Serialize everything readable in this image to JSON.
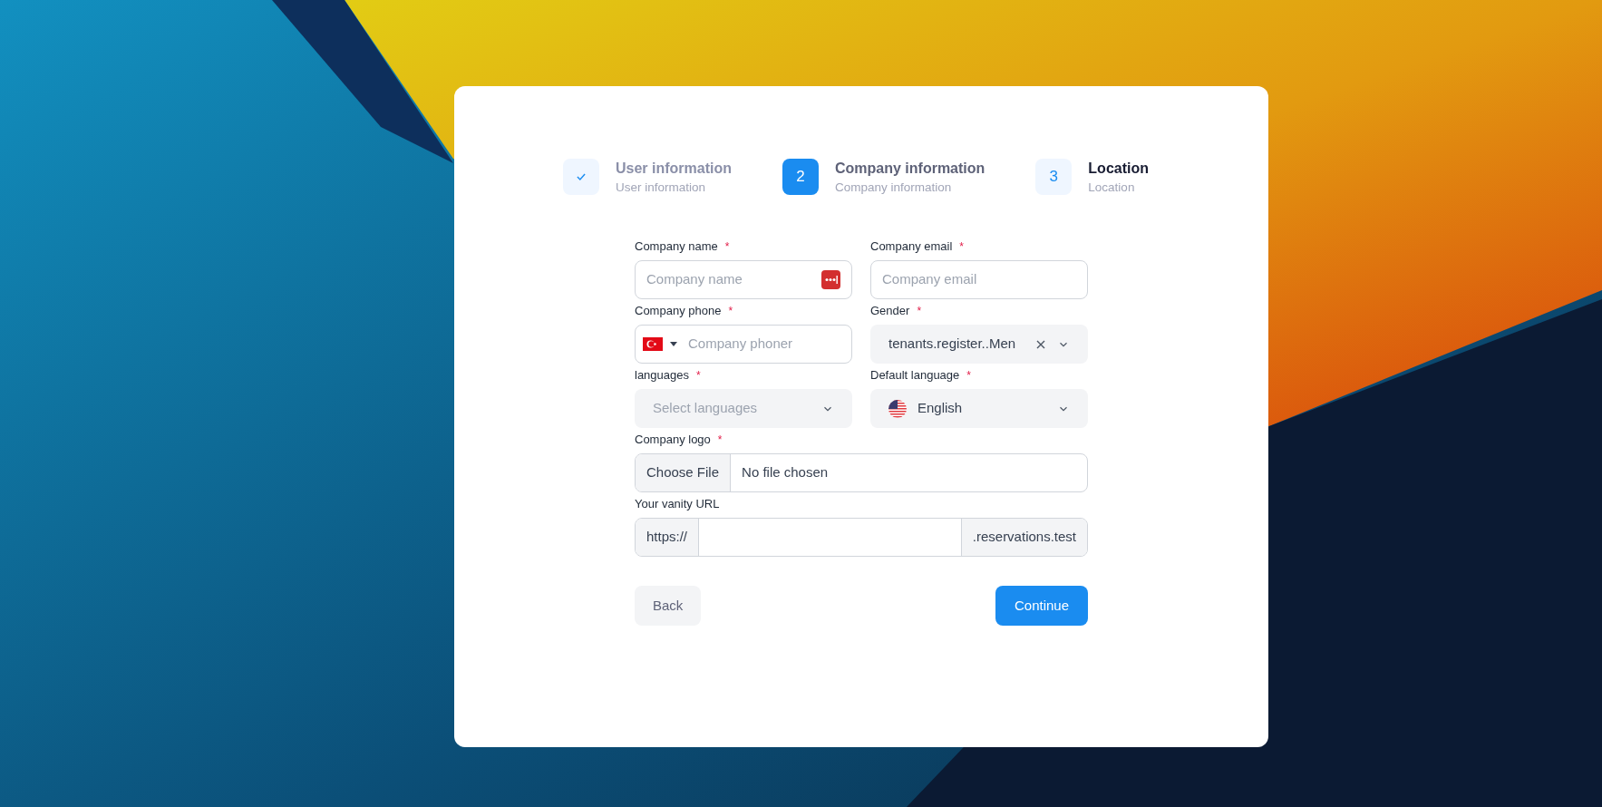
{
  "steps": [
    {
      "kind": "done",
      "title": "User information",
      "subtitle": "User information"
    },
    {
      "kind": "current",
      "number": "2",
      "title": "Company information",
      "subtitle": "Company information"
    },
    {
      "kind": "pending",
      "number": "3",
      "title": "Location",
      "subtitle": "Location"
    }
  ],
  "fields": [
    {
      "kind": "text",
      "label": "Company name",
      "mark": "*",
      "placeholder": "Company name",
      "password_manager": true
    },
    {
      "kind": "text",
      "label": "Company email",
      "mark": "*",
      "placeholder": "Company email"
    },
    {
      "kind": "phone",
      "label": "Company phone",
      "mark": "*",
      "placeholder": "Company phoner"
    },
    {
      "kind": "select",
      "label": "Gender",
      "mark": "*",
      "value": "tenants.register..Men",
      "clearable": true
    },
    {
      "kind": "select",
      "label": "languages",
      "mark": "*",
      "placeholder": "Select languages"
    },
    {
      "kind": "flag-select",
      "label": "Default language",
      "mark": "*",
      "value": "English"
    },
    {
      "kind": "file",
      "label": "Company logo",
      "mark": "*",
      "button": "Choose File",
      "status": "No file chosen"
    },
    {
      "kind": "url",
      "label": "Your vanity URL",
      "prefix": "https://",
      "suffix": ".reservations.test"
    }
  ],
  "buttons": {
    "back": "Back",
    "continue": "Continue"
  }
}
